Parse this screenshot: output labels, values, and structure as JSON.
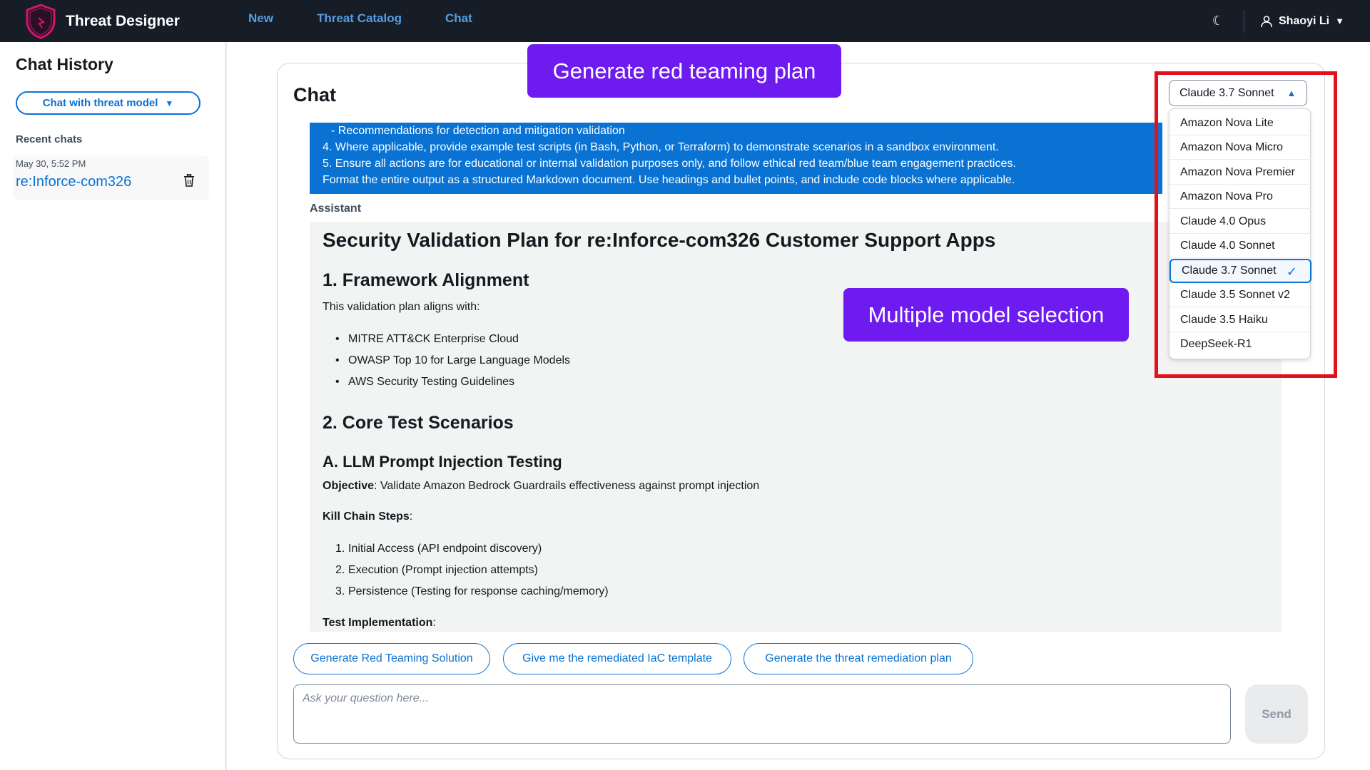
{
  "app": {
    "title": "Threat Designer"
  },
  "nav": {
    "links": [
      "New",
      "Threat Catalog",
      "Chat"
    ],
    "user": "Shaoyi Li"
  },
  "sidebar": {
    "title": "Chat History",
    "select_label": "Chat with threat model",
    "recent_label": "Recent chats",
    "items": [
      {
        "date": "May 30, 5:52 PM",
        "name": "re:Inforce-com326"
      }
    ]
  },
  "chat": {
    "title": "Chat",
    "user_message_lines": [
      "- Recommendations for detection and mitigation validation",
      "4. Where applicable, provide example test scripts (in Bash, Python, or Terraform) to demonstrate scenarios in a sandbox environment.",
      "5. Ensure all actions are for educational or internal validation purposes only, and follow ethical red team/blue team engagement practices.",
      "Format the entire output as a structured Markdown document. Use headings and bullet points, and include code blocks where applicable."
    ],
    "assistant_label": "Assistant",
    "assistant": {
      "title": "Security Validation Plan for re:Inforce-com326 Customer Support Apps",
      "s1_heading": "1. Framework Alignment",
      "s1_intro": "This validation plan aligns with:",
      "s1_bullets": [
        "MITRE ATT&CK Enterprise Cloud",
        "OWASP Top 10 for Large Language Models",
        "AWS Security Testing Guidelines"
      ],
      "s2_heading": "2. Core Test Scenarios",
      "s2a_heading": "A. LLM Prompt Injection Testing",
      "objective_label": "Objective",
      "objective_text": ": Validate Amazon Bedrock Guardrails effectiveness against prompt injection",
      "kill_chain_label": "Kill Chain Steps",
      "kill_chain_colon": ":",
      "steps": [
        "Initial Access (API endpoint discovery)",
        "Execution (Prompt injection attempts)",
        "Persistence (Testing for response caching/memory)"
      ],
      "step_numbers": [
        "1.",
        "2.",
        "3."
      ],
      "test_impl_label": "Test Implementation",
      "test_impl_colon": ":"
    },
    "suggestions": [
      "Generate Red Teaming Solution",
      "Give me the remediated IaC template",
      "Generate the threat remediation plan"
    ],
    "input_placeholder": "Ask your question here...",
    "send_label": "Send"
  },
  "callouts": {
    "top": "Generate red teaming plan",
    "middle": "Multiple model selection"
  },
  "model_selector": {
    "selected": "Claude 3.7 Sonnet",
    "options": [
      "Amazon Nova Lite",
      "Amazon Nova Micro",
      "Amazon Nova Premier",
      "Amazon Nova Pro",
      "Claude 4.0 Opus",
      "Claude 4.0 Sonnet",
      "Claude 3.7 Sonnet",
      "Claude 3.5 Sonnet v2",
      "Claude 3.5 Haiku",
      "DeepSeek-R1"
    ]
  },
  "colors": {
    "nav_bg": "#161d26",
    "link": "#539fe5",
    "accent": "#0972d3",
    "callout": "#6e1bf0",
    "highlight": "#e1121c"
  }
}
